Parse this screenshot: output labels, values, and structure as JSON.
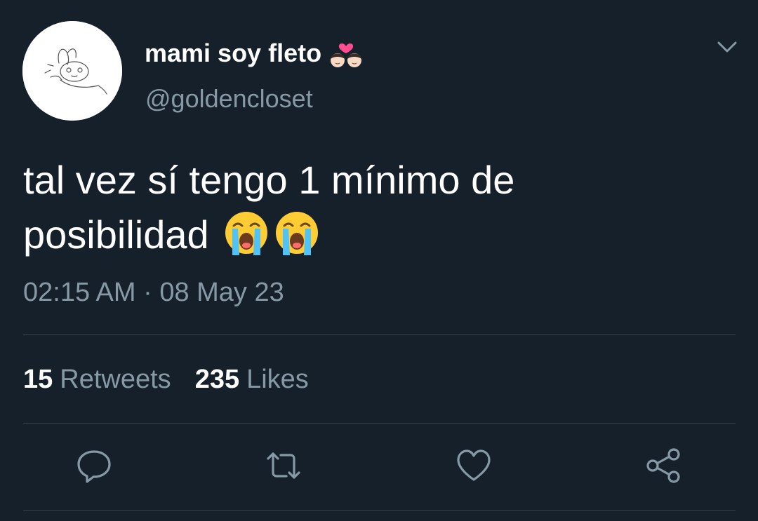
{
  "user": {
    "display_name": "mami soy fleto",
    "name_emoji": "couple-with-heart-emoji",
    "handle": "@goldencloset"
  },
  "tweet": {
    "text_line1": "tal vez sí tengo 1 mínimo de",
    "text_line2": "posibilidad",
    "emojis": [
      "loudly-crying-face-emoji",
      "loudly-crying-face-emoji"
    ],
    "timestamp": "02:15 AM · 08 May 23"
  },
  "stats": {
    "retweets_count": "15",
    "retweets_label": "Retweets",
    "likes_count": "235",
    "likes_label": "Likes"
  },
  "actions": [
    "reply-icon",
    "retweet-icon",
    "like-icon",
    "share-icon"
  ],
  "colors": {
    "background": "#15202b",
    "text_primary": "#ffffff",
    "text_secondary": "#8899a6",
    "divider": "#38444d"
  }
}
